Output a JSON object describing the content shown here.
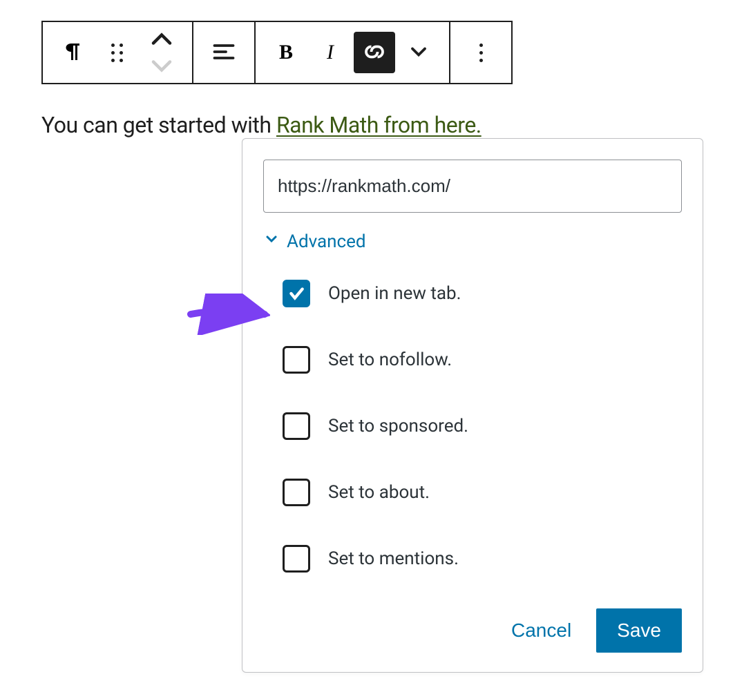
{
  "toolbar": {
    "paragraph_icon": "paragraph",
    "drag_icon": "drag-handle",
    "move_icon": "move-updown",
    "align_icon": "align-left",
    "bold_label": "B",
    "italic_label": "I",
    "link_icon": "link",
    "chevron_icon": "chevron-down",
    "more_icon": "more-vertical"
  },
  "content": {
    "prefix_text": "You can get started with ",
    "link_text": "Rank Math from here."
  },
  "link_popover": {
    "url_value": "https://rankmath.com/",
    "advanced_label": "Advanced",
    "options": [
      {
        "key": "new_tab",
        "label": "Open in new tab.",
        "checked": true
      },
      {
        "key": "nofollow",
        "label": "Set to nofollow.",
        "checked": false
      },
      {
        "key": "sponsored",
        "label": "Set to sponsored.",
        "checked": false
      },
      {
        "key": "about",
        "label": "Set to about.",
        "checked": false
      },
      {
        "key": "mentions",
        "label": "Set to mentions.",
        "checked": false
      }
    ],
    "cancel_label": "Cancel",
    "save_label": "Save"
  },
  "colors": {
    "accent": "#0073aa",
    "link_green": "#3c5a14",
    "arrow": "#7b3ff2"
  }
}
